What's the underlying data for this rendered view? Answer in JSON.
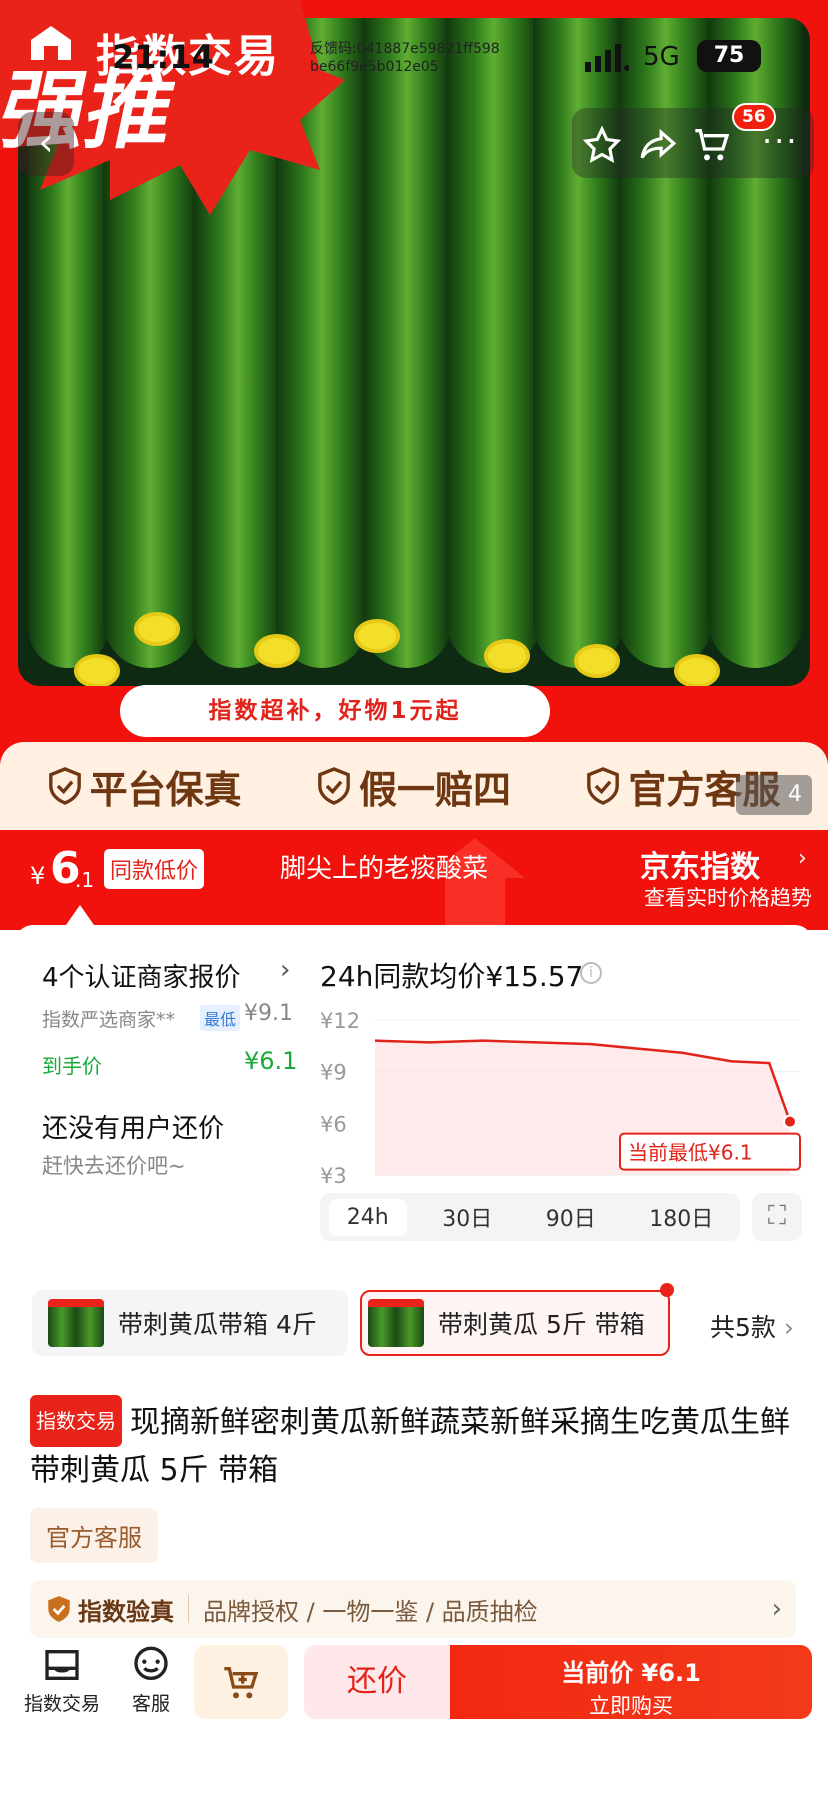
{
  "status_bar": {
    "time": "21:14",
    "feedback": "反馈码:041887e59821ff598 be66f9e5b012e05",
    "network": "5G",
    "battery": "75"
  },
  "app_logo": {
    "name": "指数交易"
  },
  "promo": {
    "burst_text": "强推",
    "ribbon": "指数超补，好物1元起"
  },
  "nav": {
    "cart_badge": "56"
  },
  "guarantees": [
    "平台保真",
    "假一赔四",
    "官方客服"
  ],
  "gallery_index": "4",
  "price_band": {
    "currency": "¥",
    "price_int": "6",
    "price_dec": ".1",
    "low_tag": "同款低价",
    "slogan": "脚尖上的老痰酸菜",
    "jd_index": "京东指数",
    "jd_sub": "查看实时价格趋势"
  },
  "merchants": {
    "title": "4个认证商家报价",
    "merchant": "指数严选商家**",
    "lowest_tag": "最低",
    "merchant_price": "¥9.1",
    "final_label": "到手价",
    "final_price": "¥6.1",
    "bargain_title": "还没有用户还价",
    "bargain_sub": "赶快去还价吧~"
  },
  "chart_data": {
    "type": "line",
    "title": "24h同款均价¥15.57",
    "xlabel": "",
    "ylabel": "",
    "y_ticks": [
      "¥12",
      "¥9",
      "¥6",
      "¥3"
    ],
    "ylim": [
      3,
      12
    ],
    "series": [
      {
        "name": "",
        "x": [
          0,
          0.13,
          0.26,
          0.39,
          0.52,
          0.65,
          0.74,
          0.86,
          0.95,
          1.0
        ],
        "values": [
          10.8,
          10.7,
          10.8,
          10.7,
          10.6,
          10.3,
          10.1,
          9.6,
          9.5,
          6.1
        ]
      }
    ],
    "annotation": "当前最低¥6.1",
    "tabs": [
      "24h",
      "30日",
      "90日",
      "180日"
    ],
    "active_tab": "24h",
    "accent": "#e1231a"
  },
  "skus": [
    {
      "label": "带刺黄瓜带箱 4斤",
      "selected": false
    },
    {
      "label": "带刺黄瓜 5斤 带箱",
      "selected": true
    }
  ],
  "sku_total": "共5款",
  "product": {
    "tag": "指数交易",
    "title": "现摘新鲜密刺黄瓜新鲜蔬菜新鲜采摘生吃黄瓜生鲜 带刺黄瓜 5斤 带箱",
    "service_tag": "官方客服"
  },
  "verify": {
    "title": "指数验真",
    "items": "品牌授权 / 一物一鉴 / 品质抽检"
  },
  "bottom": {
    "home_label": "指数交易",
    "service_label": "客服",
    "bargain": "还价",
    "buy_price": "当前价 ¥6.1",
    "buy_now": "立即购买"
  },
  "colors": {
    "brand_red": "#f2120d",
    "cream": "#fff0e2",
    "green_price": "#1aaa3a"
  }
}
